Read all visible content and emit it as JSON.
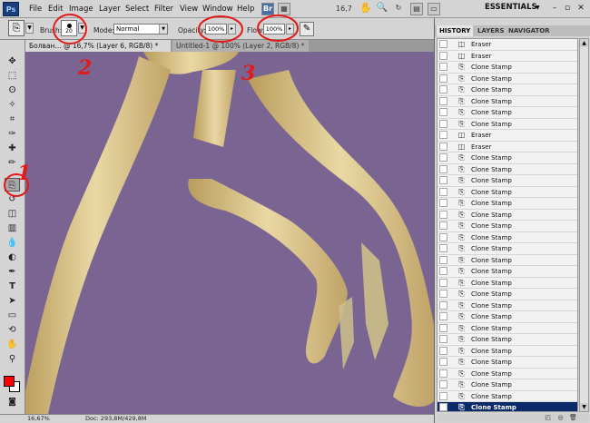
{
  "app": {
    "logo": "Ps"
  },
  "menu": [
    "File",
    "Edit",
    "Image",
    "Layer",
    "Select",
    "Filter",
    "View",
    "Window",
    "Help"
  ],
  "menubar_right": {
    "br_label": "Br",
    "zoom": "16,7",
    "workspace": "ESSENTIALS"
  },
  "options": {
    "brush_label": "Brush:",
    "brush_size": "20",
    "mode_label": "Mode:",
    "mode_value": "Normal",
    "opacity_label": "Opacity:",
    "opacity_value": "100%",
    "flow_label": "Flow:",
    "flow_value": "100%"
  },
  "documents": [
    {
      "title": "Болван... @ 16,7% (Layer 6, RGB/8) *"
    },
    {
      "title": "Untitled-1 @ 100% (Layer 2, RGB/8) *"
    }
  ],
  "status": {
    "zoom": "16,67%",
    "doc": "Doc: 293,8M/429,8M"
  },
  "history_panel": {
    "tabs": [
      "HISTORY",
      "LAYERS",
      "NAVIGATOR"
    ],
    "rows": [
      "Eraser",
      "Eraser",
      "Clone Stamp",
      "Clone Stamp",
      "Clone Stamp",
      "Clone Stamp",
      "Clone Stamp",
      "Clone Stamp",
      "Eraser",
      "Eraser",
      "Clone Stamp",
      "Clone Stamp",
      "Clone Stamp",
      "Clone Stamp",
      "Clone Stamp",
      "Clone Stamp",
      "Clone Stamp",
      "Clone Stamp",
      "Clone Stamp",
      "Clone Stamp",
      "Clone Stamp",
      "Clone Stamp",
      "Clone Stamp",
      "Clone Stamp",
      "Clone Stamp",
      "Clone Stamp",
      "Clone Stamp",
      "Clone Stamp",
      "Clone Stamp",
      "Clone Stamp",
      "Clone Stamp",
      "Clone Stamp",
      "Clone Stamp"
    ],
    "selected_index": 32
  },
  "annotations": [
    "1",
    "2",
    "3"
  ],
  "colors": {
    "foreground": "#ff0000",
    "background": "#ffffff",
    "canvas": "#7a6592"
  }
}
